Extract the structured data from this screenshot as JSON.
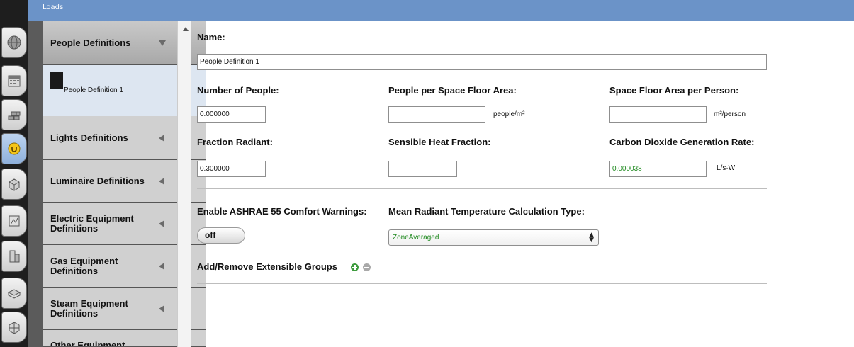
{
  "window": {
    "title": "Loads"
  },
  "icon_tabs": [
    {
      "icon": "globe-icon"
    },
    {
      "icon": "calendar-icon"
    },
    {
      "icon": "construction-icon"
    },
    {
      "icon": "loads-plug-icon",
      "active": true
    },
    {
      "icon": "space-types-icon"
    },
    {
      "icon": "geometry-icon"
    },
    {
      "icon": "facility-icon"
    },
    {
      "icon": "spaces-icon"
    },
    {
      "icon": "thermal-zones-icon"
    }
  ],
  "categories": {
    "people": {
      "label": "People Definitions"
    },
    "people_item": {
      "label": "People Definition 1"
    },
    "lights": {
      "label": "Lights Definitions"
    },
    "luminaire": {
      "label": "Luminaire Definitions"
    },
    "electric": {
      "label": "Electric Equipment Definitions"
    },
    "gas": {
      "label": "Gas Equipment Definitions"
    },
    "steam": {
      "label": "Steam Equipment Definitions"
    },
    "other": {
      "label": "Other Equipment"
    }
  },
  "form": {
    "name_label": "Name:",
    "name_value": "People Definition 1",
    "num_people_label": "Number of People:",
    "num_people_value": "0.000000",
    "people_per_area_label": "People per Space Floor Area:",
    "people_per_area_value": "",
    "people_per_area_unit": "people/m²",
    "area_per_person_label": "Space Floor Area per Person:",
    "area_per_person_value": "",
    "area_per_person_unit": "m²/person",
    "fraction_radiant_label": "Fraction Radiant:",
    "fraction_radiant_value": "0.300000",
    "sensible_heat_label": "Sensible Heat Fraction:",
    "sensible_heat_value": "",
    "co2_label": "Carbon Dioxide Generation Rate:",
    "co2_value": "0.000038",
    "co2_unit": "L/s·W",
    "ashrae_label": "Enable ASHRAE 55 Comfort Warnings:",
    "ashrae_toggle": "off",
    "mrt_label": "Mean Radiant Temperature Calculation Type:",
    "mrt_value": "ZoneAveraged",
    "extensible_label": "Add/Remove Extensible Groups"
  },
  "colors": {
    "header": "#6b93c8",
    "active_tab": "#8fb1dc",
    "value_green": "#1f8a1f",
    "add_green": "#3d9b3d"
  }
}
